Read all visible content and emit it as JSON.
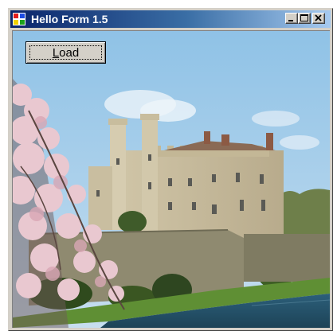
{
  "window": {
    "title": "Hello Form 1.5",
    "controls": {
      "minimize": "minimize",
      "maximize": "maximize",
      "close": "close"
    }
  },
  "form": {
    "load_button_label": "Load",
    "load_button_accelerator": "L",
    "picture": "castle-photo"
  },
  "colors": {
    "titlebar_start": "#0a246a",
    "titlebar_end": "#a6caf0",
    "face": "#d4d0c8"
  }
}
